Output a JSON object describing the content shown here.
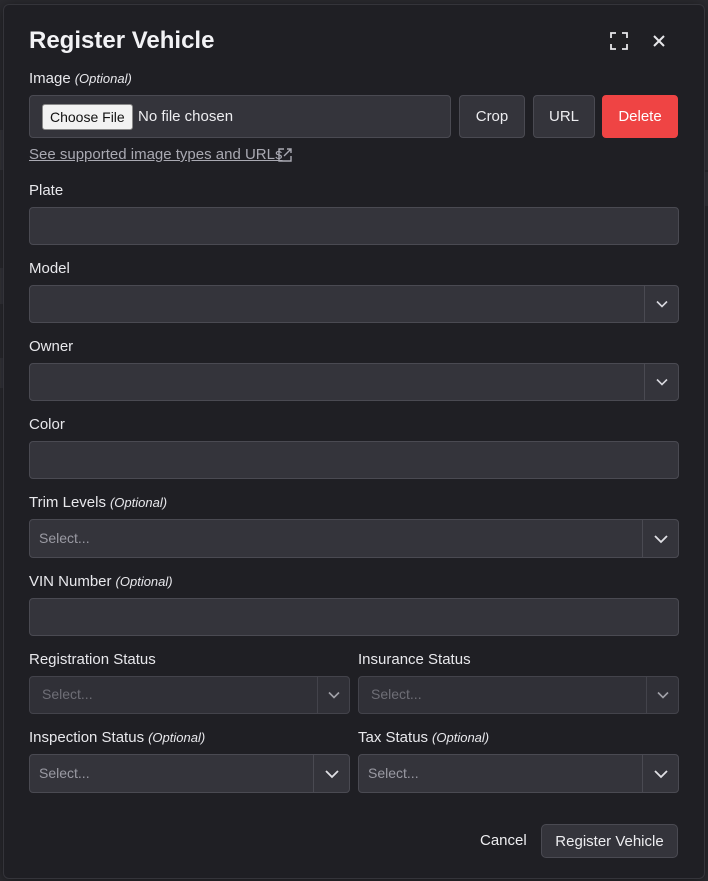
{
  "dialog": {
    "title": "Register Vehicle"
  },
  "image": {
    "label": "Image",
    "optional": "(Optional)",
    "choose_file": "Choose File",
    "no_file": "No file chosen",
    "crop": "Crop",
    "url": "URL",
    "delete": "Delete",
    "help_link": "See supported image types and URLs"
  },
  "fields": {
    "plate": {
      "label": "Plate",
      "value": ""
    },
    "model": {
      "label": "Model",
      "value": ""
    },
    "owner": {
      "label": "Owner",
      "value": ""
    },
    "color": {
      "label": "Color",
      "value": ""
    },
    "trim_levels": {
      "label": "Trim Levels",
      "optional": "(Optional)",
      "placeholder": "Select..."
    },
    "vin": {
      "label": "VIN Number",
      "optional": "(Optional)",
      "value": ""
    },
    "registration_status": {
      "label": "Registration Status",
      "placeholder": "Select..."
    },
    "insurance_status": {
      "label": "Insurance Status",
      "placeholder": "Select..."
    },
    "inspection_status": {
      "label": "Inspection Status",
      "optional": "(Optional)",
      "placeholder": "Select..."
    },
    "tax_status": {
      "label": "Tax Status",
      "optional": "(Optional)",
      "placeholder": "Select..."
    }
  },
  "footer": {
    "cancel": "Cancel",
    "submit": "Register Vehicle"
  },
  "icons": {
    "maximize": "maximize-icon",
    "close": "close-icon",
    "external_link": "external-link-icon",
    "chevron": "chevron-down-icon"
  },
  "colors": {
    "danger": "#ef4444",
    "modal_bg": "#1f1f24",
    "field_bg": "#34343b"
  }
}
